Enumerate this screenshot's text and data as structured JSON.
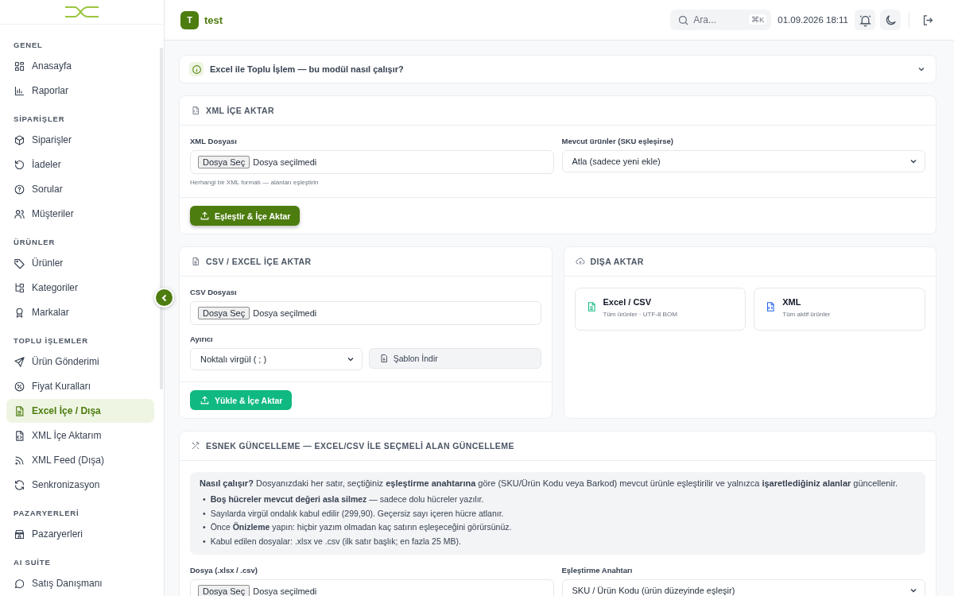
{
  "sidebar": {
    "sections": [
      {
        "title": "GENEL",
        "items": [
          {
            "label": "Anasayfa",
            "selected": false
          },
          {
            "label": "Raporlar",
            "selected": false
          }
        ]
      },
      {
        "title": "SİPARİŞLER",
        "items": [
          {
            "label": "Siparişler",
            "selected": false
          },
          {
            "label": "İadeler",
            "selected": false
          },
          {
            "label": "Sorular",
            "selected": false
          },
          {
            "label": "Müşteriler",
            "selected": false
          }
        ]
      },
      {
        "title": "ÜRÜNLER",
        "items": [
          {
            "label": "Ürünler",
            "selected": false
          },
          {
            "label": "Kategoriler",
            "selected": false
          },
          {
            "label": "Markalar",
            "selected": false
          }
        ]
      },
      {
        "title": "TOPLU İŞLEMLER",
        "items": [
          {
            "label": "Ürün Gönderimi",
            "selected": false
          },
          {
            "label": "Fiyat Kuralları",
            "selected": false
          },
          {
            "label": "Excel İçe / Dışa",
            "selected": true
          },
          {
            "label": "XML İçe Aktarım",
            "selected": false
          },
          {
            "label": "XML Feed (Dışa)",
            "selected": false
          },
          {
            "label": "Senkronizasyon",
            "selected": false
          }
        ]
      },
      {
        "title": "PAZARYERLERİ",
        "items": [
          {
            "label": "Pazaryerleri",
            "selected": false
          }
        ]
      },
      {
        "title": "AI SUİTE",
        "items": [
          {
            "label": "Satış Danışmanı",
            "selected": false
          }
        ]
      }
    ]
  },
  "header": {
    "avatar": "T",
    "user": "test",
    "search": {
      "placeholder": "Ara...",
      "shortcut": "⌘K"
    },
    "datetime": "01.09.2026 18:11"
  },
  "info_bar": {
    "text": "Excel ile Toplu İşlem — bu modül nasıl çalışır?",
    "expanded": false
  },
  "xml_import": {
    "title": "XML İÇE AKTAR",
    "file_label": "XML Dosyası",
    "file_button": "Dosya Seç",
    "file_status": "Dosya seçilmedi",
    "hint": "Herhangi bir XML formatı — alanları eşleştirin",
    "existing_label": "Mevcut ürünler (SKU eşleşirse)",
    "existing_value": "Atla (sadece yeni ekle)",
    "button": "Eşleştir & İçe Aktar"
  },
  "csv_import": {
    "title": "CSV / EXCEL İÇE AKTAR",
    "file_label": "CSV Dosyası",
    "file_button": "Dosya Seç",
    "file_status": "Dosya seçilmedi",
    "separator_label": "Ayırıcı",
    "separator_value": "Noktalı virgül ( ; )",
    "template_button": "Şablon İndir",
    "button": "Yükle & İçe Aktar"
  },
  "export": {
    "title": "DIŞA AKTAR",
    "options": [
      {
        "kind": "sheet",
        "title": "Excel / CSV",
        "subtitle": "Tüm ürünler · UTF-8 BOM"
      },
      {
        "kind": "code",
        "title": "XML",
        "subtitle": "Tüm aktif ürünler"
      }
    ]
  },
  "flex_update": {
    "title": "ESNEK GÜNCELLEME — EXCEL/CSV İLE SEÇMELİ ALAN GÜNCELLEME",
    "intro": "**Nasıl çalışır?** Dosyanızdaki her satır, seçtiğiniz **eşleştirme anahtarına** göre (SKU/Ürün Kodu veya Barkod) mevcut ürünle eşleştirilir ve yalnızca **işaretlediğiniz alanlar** güncellenir.",
    "bullets": [
      {
        "marker": "•",
        "text": "**Boş hücreler mevcut değeri asla silmez** — sadece dolu hücreler yazılır."
      },
      {
        "marker": "•",
        "text": "Sayılarda virgül ondalık kabul edilir (299,90). Geçersiz sayı içeren hücre atlanır."
      },
      {
        "marker": "•",
        "text": "Önce **Önizleme** yapın: hiçbir yazım olmadan kaç satırın eşleşeceğini görürsünüz."
      },
      {
        "marker": "•",
        "text": "Kabul edilen dosyalar: .xlsx ve .csv (ilk satır başlık; en fazla 25 MB)."
      }
    ],
    "file_label": "Dosya (.xlsx / .csv)",
    "file_button": "Dosya Seç",
    "file_status": "Dosya seçilmedi",
    "key_label": "Eşleştirme Anahtarı",
    "key_value": "SKU / Ürün Kodu (ürün düzeyinde eşleşir)"
  }
}
